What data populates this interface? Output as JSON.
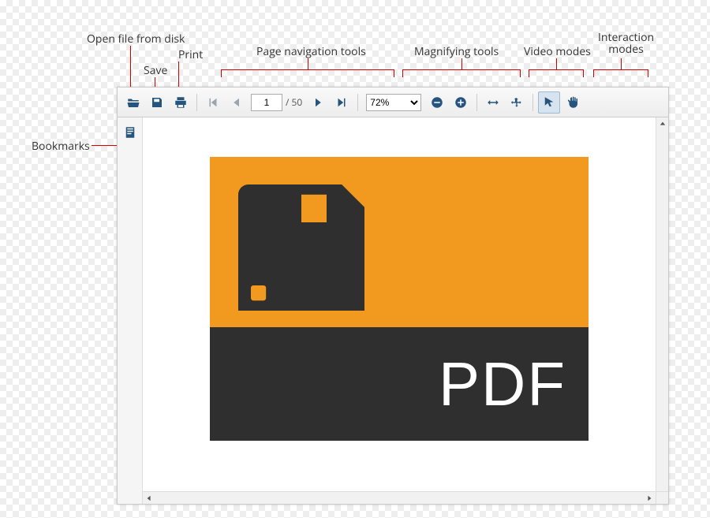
{
  "annotations": {
    "open": "Open file from disk",
    "save": "Save",
    "print": "Print",
    "nav": "Page navigation tools",
    "magnify": "Magnifying tools",
    "video": "Video modes",
    "interaction": "Interaction modes",
    "bookmarks": "Bookmarks"
  },
  "toolbar": {
    "current_page": "1",
    "total_pages": "50",
    "page_separator": "/",
    "zoom": "72%"
  },
  "document": {
    "logo_text": "PDF"
  },
  "colors": {
    "icon": "#25547c",
    "accent_orange": "#f29a1f",
    "accent_dark": "#2f2f2f",
    "callout": "#d40000"
  }
}
